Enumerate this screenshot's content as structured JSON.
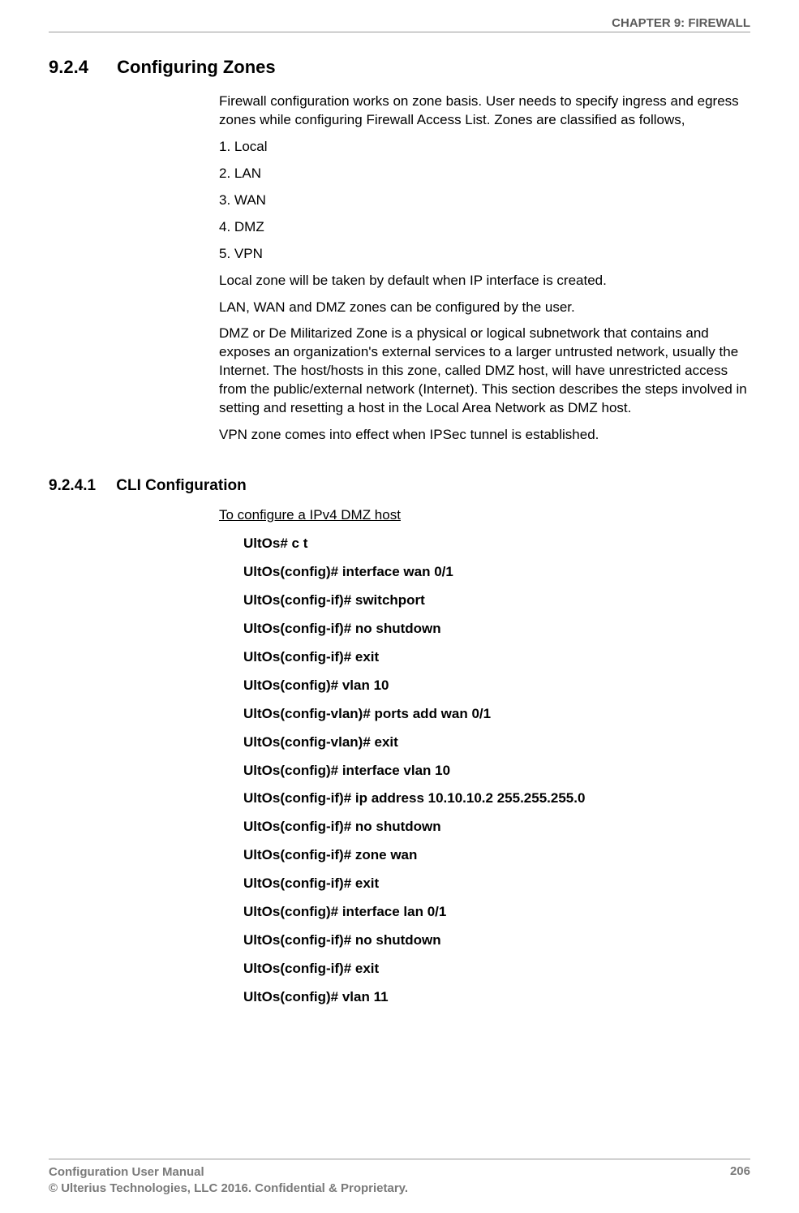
{
  "header": {
    "chapter": "CHAPTER 9: FIREWALL"
  },
  "section": {
    "number": "9.2.4",
    "title": "Configuring Zones"
  },
  "body": {
    "intro": "Firewall configuration works on zone basis. User needs to specify ingress and egress zones while configuring Firewall Access List.  Zones are classified as follows,",
    "zones": [
      "1. Local",
      "2. LAN",
      "3. WAN",
      "4. DMZ",
      "5. VPN"
    ],
    "p_local": "Local zone will be taken by default when IP interface is created.",
    "p_lan": "LAN, WAN and DMZ zones can be configured by the user.",
    "p_dmz": "DMZ or De Militarized Zone is a physical or logical subnetwork that contains and exposes an organization's external services to a larger untrusted network, usually the Internet. The host/hosts in this zone, called DMZ host, will have unrestricted access from the public/external network (Internet). This section describes the steps involved in setting and resetting a host in the Local Area Network as DMZ host.",
    "p_vpn": "VPN zone comes into effect when IPSec tunnel is established."
  },
  "subsection": {
    "number": "9.2.4.1",
    "title": "CLI Configuration",
    "config_title": "To configure a IPv4 DMZ host",
    "cli": [
      "UltOs# c t",
      "UltOs(config)# interface wan 0/1",
      "UltOs(config-if)# switchport",
      "UltOs(config-if)# no shutdown",
      "UltOs(config-if)# exit",
      "UltOs(config)# vlan 10",
      "UltOs(config-vlan)# ports add wan 0/1",
      "UltOs(config-vlan)# exit",
      "UltOs(config)# interface vlan 10",
      "UltOs(config-if)# ip address 10.10.10.2 255.255.255.0",
      "UltOs(config-if)# no shutdown",
      "UltOs(config-if)# zone wan",
      "UltOs(config-if)# exit",
      "UltOs(config)# interface lan 0/1",
      "UltOs(config-if)# no shutdown",
      "UltOs(config-if)# exit",
      "UltOs(config)# vlan 11"
    ]
  },
  "footer": {
    "left1": "Configuration User Manual",
    "left2": "© Ulterius Technologies, LLC 2016. Confidential & Proprietary.",
    "page": "206"
  }
}
